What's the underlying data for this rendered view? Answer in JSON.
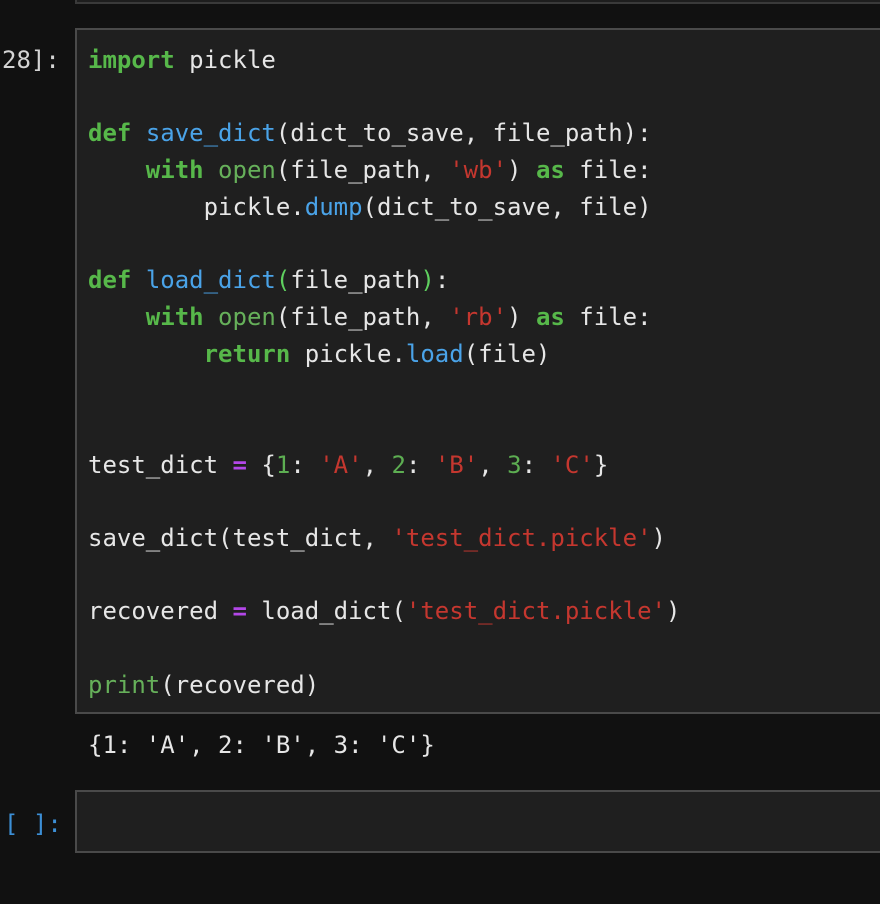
{
  "previous_cell": {},
  "cell_1": {
    "prompt": "28]:",
    "code": {
      "l1": {
        "kw": "import",
        "rest": " pickle"
      },
      "l3": {
        "kw": "def",
        "sp": " ",
        "fn": "save_dict",
        "rest": "(dict_to_save, file_path):"
      },
      "l4": {
        "indent": "    ",
        "kw": "with",
        "sp": " ",
        "bi": "open",
        "mid": "(file_path, ",
        "str": "'wb'",
        "mid2": ") ",
        "kw2": "as",
        "rest": " file:"
      },
      "l5": {
        "indent": "        ",
        "obj": "pickle.",
        "fn": "dump",
        "rest": "(dict_to_save, file)"
      },
      "l7": {
        "kw": "def",
        "sp": " ",
        "fn": "load_dict",
        "p1": "(",
        "mid": "file_path",
        "p2": ")",
        "rest": ":"
      },
      "l8": {
        "indent": "    ",
        "kw": "with",
        "sp": " ",
        "bi": "open",
        "mid": "(file_path, ",
        "str": "'rb'",
        "mid2": ") ",
        "kw2": "as",
        "rest": " file:"
      },
      "l9": {
        "indent": "        ",
        "kw": "return",
        "mid": " pickle.",
        "fn": "load",
        "rest": "(file)"
      },
      "l12": {
        "a": "test_dict ",
        "op": "=",
        "b": " {",
        "n1": "1",
        "c1": ": ",
        "s1": "'A'",
        "c2": ", ",
        "n2": "2",
        "c3": ": ",
        "s2": "'B'",
        "c4": ", ",
        "n3": "3",
        "c5": ": ",
        "s3": "'C'",
        "end": "}"
      },
      "l14": {
        "a": "save_dict(test_dict, ",
        "str": "'test_dict.pickle'",
        "end": ")"
      },
      "l16": {
        "a": "recovered ",
        "op": "=",
        "b": " load_dict(",
        "str": "'test_dict.pickle'",
        "end": ")"
      },
      "l18": {
        "bi": "print",
        "rest": "(recovered)"
      }
    },
    "output": "{1: 'A', 2: 'B', 3: 'C'}"
  },
  "cell_2": {
    "prompt": "[ ]:"
  }
}
